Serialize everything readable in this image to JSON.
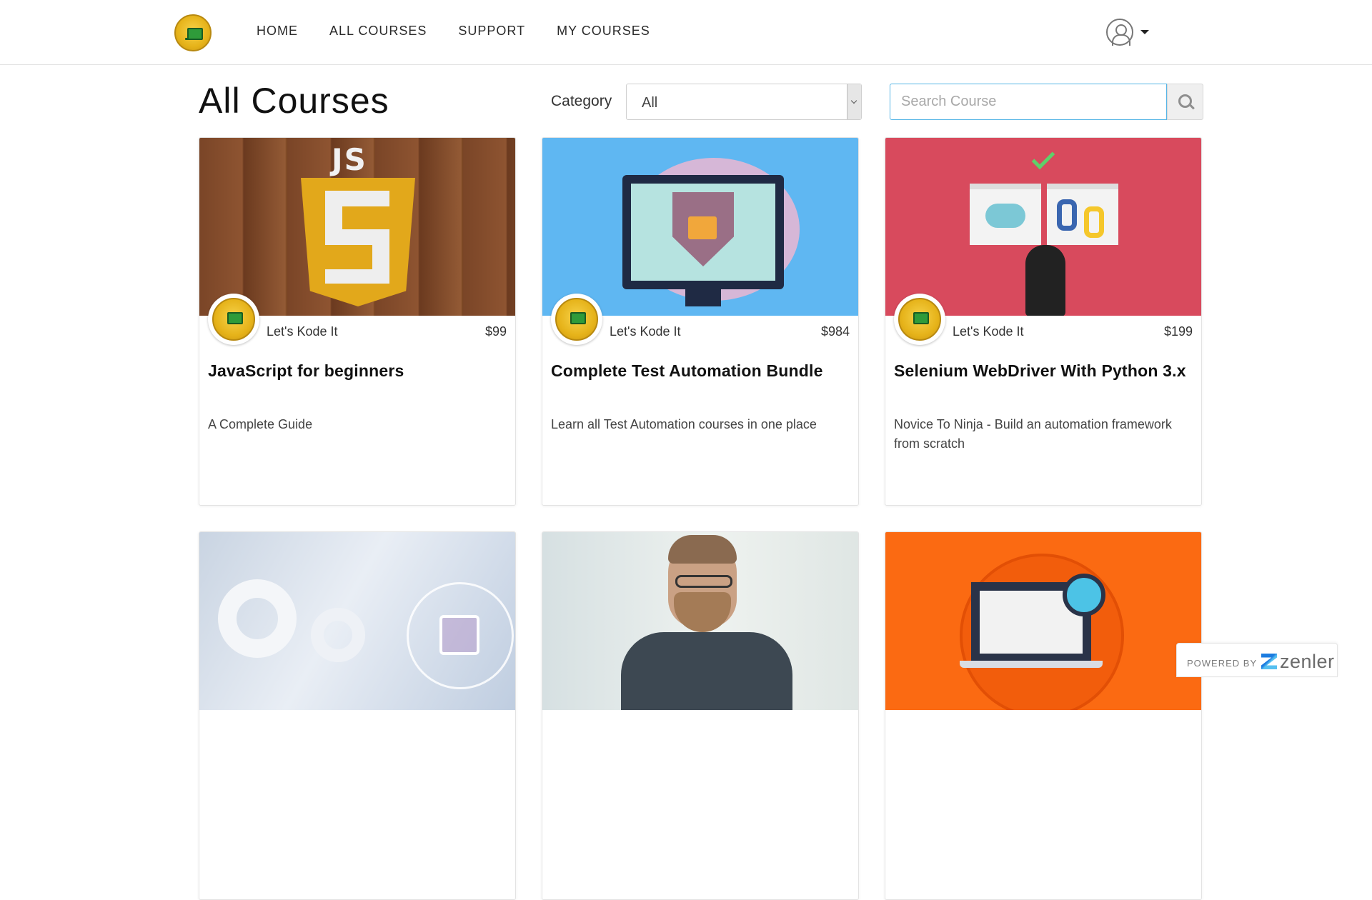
{
  "nav": {
    "items": [
      {
        "label": "HOME"
      },
      {
        "label": "ALL COURSES"
      },
      {
        "label": "SUPPORT"
      },
      {
        "label": "MY COURSES"
      }
    ]
  },
  "page": {
    "title": "All Courses"
  },
  "filters": {
    "category_label": "Category",
    "category_value": "All",
    "search_placeholder": "Search Course"
  },
  "courses": [
    {
      "author": "Let's Kode It",
      "price": "$99",
      "title": "JavaScript for beginners",
      "subtitle": "A Complete Guide",
      "image": "javascript-logo"
    },
    {
      "author": "Let's Kode It",
      "price": "$984",
      "title": "Complete Test Automation Bundle",
      "subtitle": "Learn all Test Automation courses in one place",
      "image": "security-monitor-illustration"
    },
    {
      "author": "Let's Kode It",
      "price": "$199",
      "title": "Selenium WebDriver With Python 3.x",
      "subtitle": "Novice To Ninja - Build an automation framework from scratch",
      "image": "ninja-python-illustration"
    },
    {
      "image": "gears-keyboard-photo"
    },
    {
      "image": "man-laptop-photo"
    },
    {
      "image": "laptop-magnifier-illustration"
    }
  ],
  "footer": {
    "powered_by": "POWERED BY",
    "brand": "zenler"
  },
  "colors": {
    "search_border": "#56b5e6",
    "card_border": "#e3e3e3",
    "logo_gold": "#e6b31a"
  }
}
